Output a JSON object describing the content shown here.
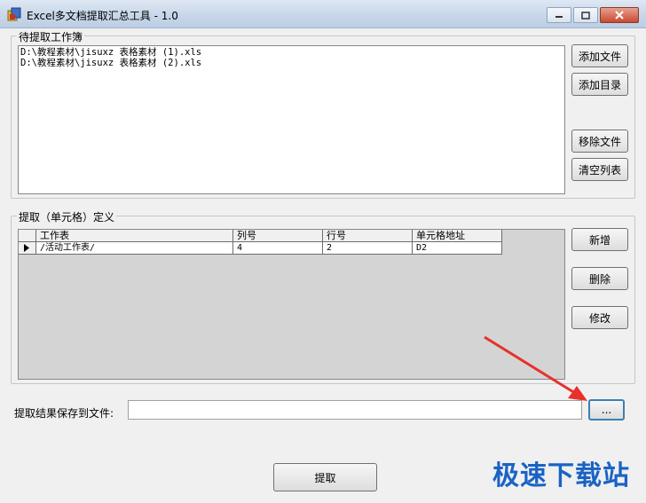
{
  "window": {
    "title": "Excel多文档提取汇总工具 - 1.0"
  },
  "workbooks": {
    "label": "待提取工作簿",
    "files": [
      "D:\\教程素材\\jisuxz 表格素材 (1).xls",
      "D:\\教程素材\\jisuxz 表格素材 (2).xls"
    ],
    "buttons": {
      "add_file": "添加文件",
      "add_dir": "添加目录",
      "remove_file": "移除文件",
      "clear_list": "清空列表"
    }
  },
  "cells": {
    "label": "提取（单元格）定义",
    "columns": [
      "工作表",
      "列号",
      "行号",
      "单元格地址"
    ],
    "rows": [
      [
        "/活动工作表/",
        "4",
        "2",
        "D2"
      ]
    ],
    "buttons": {
      "add": "新增",
      "delete": "删除",
      "edit": "修改"
    }
  },
  "output": {
    "label": "提取结果保存到文件:",
    "value": "",
    "browse": "..."
  },
  "footer": {
    "extract": "提取"
  },
  "watermark": "极速下载站",
  "colors": {
    "arrow": "#e8312a",
    "watermark": "#1a63c5"
  }
}
